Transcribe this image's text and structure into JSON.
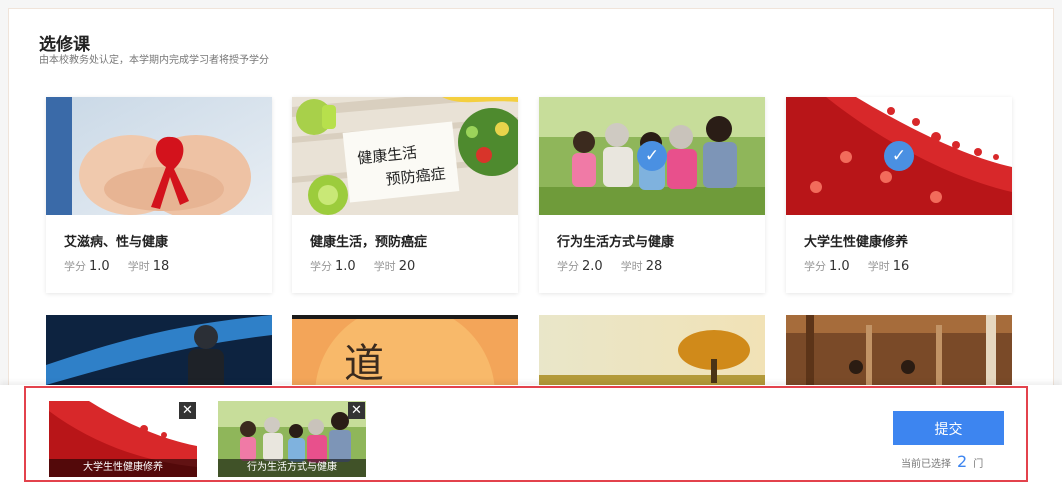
{
  "header": {
    "title": "选修课",
    "subtitle": "由本校教务处认定，本学期内完成学习者将授予学分"
  },
  "courses": [
    {
      "name": "艾滋病、性与健康",
      "credit_label": "学分",
      "credit": "1.0",
      "hours_label": "学时",
      "hours": "18",
      "selected": false,
      "image": "red-ribbon-hands"
    },
    {
      "name": "健康生活，预防癌症",
      "credit_label": "学分",
      "credit": "1.0",
      "hours_label": "学时",
      "hours": "20",
      "selected": false,
      "image": "healthy-food-note",
      "image_text": "健康生活\n预防癌症"
    },
    {
      "name": "行为生活方式与健康",
      "credit_label": "学分",
      "credit": "2.0",
      "hours_label": "学时",
      "hours": "28",
      "selected": true,
      "image": "family-outdoor"
    },
    {
      "name": "大学生性健康修养",
      "credit_label": "学分",
      "credit": "1.0",
      "hours_label": "学时",
      "hours": "16",
      "selected": true,
      "image": "red-hearts"
    }
  ],
  "row2": [
    {
      "image": "blue-figure"
    },
    {
      "image": "orange-calligraphy",
      "image_text": "道"
    },
    {
      "image": "tree-sunset"
    },
    {
      "image": "wooden-corridor"
    }
  ],
  "selection_bar": {
    "selected": [
      {
        "name": "大学生性健康修养",
        "image": "red-hearts",
        "remove_icon": "close-icon"
      },
      {
        "name": "行为生活方式与健康",
        "image": "family-outdoor",
        "remove_icon": "close-icon"
      }
    ],
    "submit_label": "提交",
    "count_prefix": "当前已选择",
    "count": "2",
    "count_unit": "门"
  },
  "colors": {
    "accent": "#3d85f0",
    "check": "#4a90e2",
    "highlight_border": "#e3424c"
  }
}
